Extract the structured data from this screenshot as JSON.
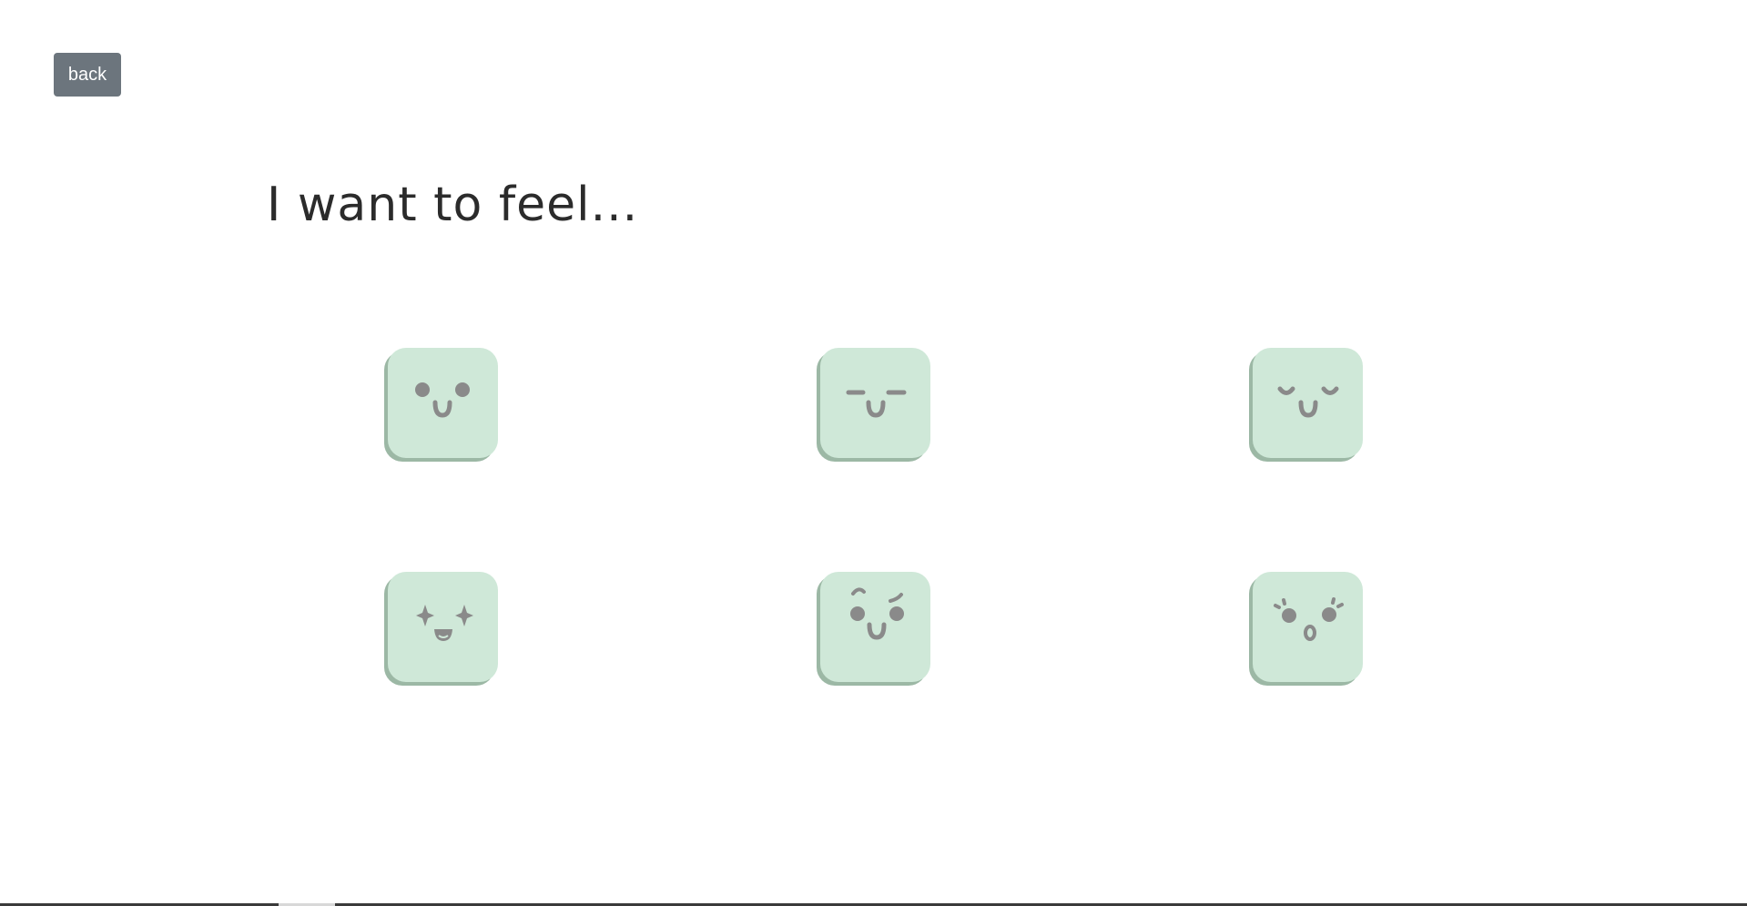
{
  "back_button": {
    "label": "back"
  },
  "heading": {
    "text": "I want to feel..."
  },
  "colors": {
    "tile_background": "#cfe8d8",
    "tile_shadow": "#9cb8a5",
    "face_features": "#8a8a8a",
    "back_button_background": "#6c757d",
    "back_button_text": "#ffffff",
    "heading_text": "#2b2b2b"
  },
  "mood_options": [
    {
      "icon": "happy-face-icon"
    },
    {
      "icon": "calm-face-icon"
    },
    {
      "icon": "content-face-icon"
    },
    {
      "icon": "excited-face-icon"
    },
    {
      "icon": "playful-face-icon"
    },
    {
      "icon": "surprised-face-icon"
    }
  ]
}
